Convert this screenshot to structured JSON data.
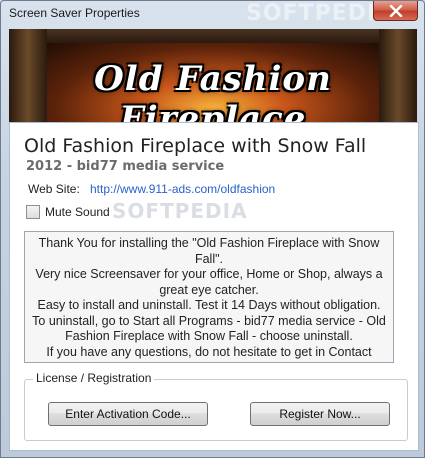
{
  "window": {
    "title": "Screen Saver Properties",
    "close_icon": "close-icon"
  },
  "banner": {
    "title": "Old Fashion Fireplace"
  },
  "app": {
    "name": "Old Fashion Fireplace with Snow Fall",
    "subtitle": "2012 - bid77 media service",
    "web_label": "Web Site:",
    "web_url": "http://www.911-ads.com/oldfashion"
  },
  "options": {
    "mute_label": "Mute Sound",
    "mute_checked": false
  },
  "message": {
    "lines": [
      "Thank You for installing the \"Old Fashion Fireplace with Snow Fall\".",
      "Very nice Screensaver for your office, Home or Shop, always a great eye catcher.",
      "Easy to install and uninstall. Test it 14 Days without obligation.",
      "To uninstall, go to Start all Programs - bid77 media service - Old Fashion Fireplace with Snow Fall - choose uninstall.",
      "If you have any questions, do not hesitate to get in Contact"
    ]
  },
  "license": {
    "group_label": "License / Registration",
    "activate_button": "Enter Activation Code...",
    "register_button": "Register Now..."
  },
  "watermark": {
    "text": "SOFTPEDIA"
  },
  "colors": {
    "link": "#2a62c9",
    "close_button": "#c0402a"
  }
}
